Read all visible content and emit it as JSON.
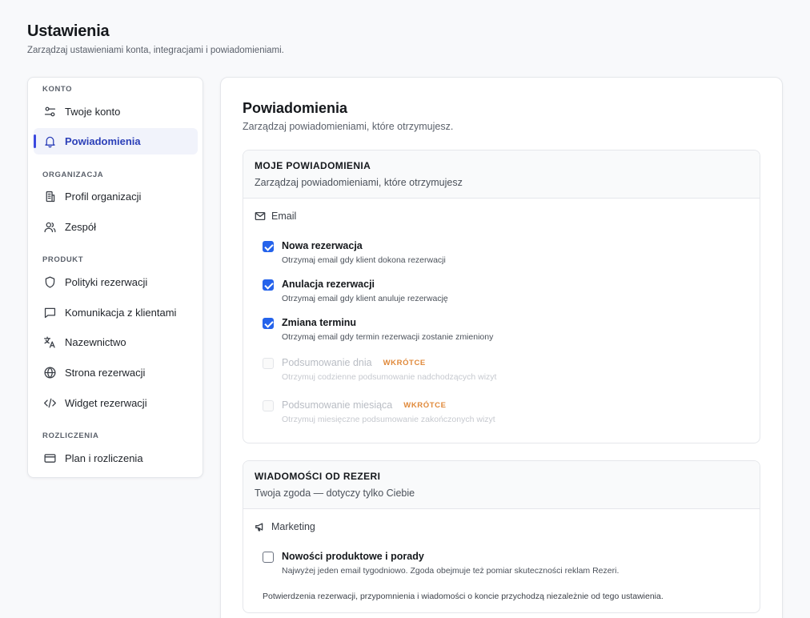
{
  "page": {
    "title": "Ustawienia",
    "subtitle": "Zarządzaj ustawieniami konta, integracjami i powiadomieniami."
  },
  "sidebar": {
    "sections": [
      {
        "heading": "KONTO",
        "items": [
          {
            "label": "Twoje konto",
            "icon": "sliders-icon"
          },
          {
            "label": "Powiadomienia",
            "icon": "bell-icon",
            "active": true
          }
        ]
      },
      {
        "heading": "ORGANIZACJA",
        "items": [
          {
            "label": "Profil organizacji",
            "icon": "building-icon"
          },
          {
            "label": "Zespół",
            "icon": "users-icon"
          }
        ]
      },
      {
        "heading": "PRODUKT",
        "items": [
          {
            "label": "Polityki rezerwacji",
            "icon": "shield-icon"
          },
          {
            "label": "Komunikacja z klientami",
            "icon": "message-icon"
          },
          {
            "label": "Nazewnictwo",
            "icon": "translate-icon"
          },
          {
            "label": "Strona rezerwacji",
            "icon": "globe-icon"
          },
          {
            "label": "Widget rezerwacji",
            "icon": "code-icon"
          }
        ]
      },
      {
        "heading": "ROZLICZENIA",
        "items": [
          {
            "label": "Plan i rozliczenia",
            "icon": "credit-card-icon"
          }
        ]
      }
    ]
  },
  "main": {
    "title": "Powiadomienia",
    "subtitle": "Zarządzaj powiadomieniami, które otrzymujesz.",
    "cards": [
      {
        "title": "MOJE POWIADOMIENIA",
        "subtitle": "Zarządzaj powiadomieniami, które otrzymujesz",
        "group": {
          "label": "Email",
          "icon": "mail-icon"
        },
        "options": [
          {
            "label": "Nowa rezerwacja",
            "desc": "Otrzymaj email gdy klient dokona rezerwacji",
            "checked": true
          },
          {
            "label": "Anulacja rezerwacji",
            "desc": "Otrzymaj email gdy klient anuluje rezerwację",
            "checked": true
          },
          {
            "label": "Zmiana terminu",
            "desc": "Otrzymaj email gdy termin rezerwacji zostanie zmieniony",
            "checked": true
          },
          {
            "label": "Podsumowanie dnia",
            "desc": "Otrzymuj codzienne podsumowanie nadchodzących wizyt",
            "checked": false,
            "disabled": true,
            "badge": "WKRÓTCE"
          },
          {
            "label": "Podsumowanie miesiąca",
            "desc": "Otrzymuj miesięczne podsumowanie zakończonych wizyt",
            "checked": false,
            "disabled": true,
            "badge": "WKRÓTCE"
          }
        ]
      },
      {
        "title": "WIADOMOŚCI OD REZERI",
        "subtitle": "Twoja zgoda — dotyczy tylko Ciebie",
        "group": {
          "label": "Marketing",
          "icon": "megaphone-icon"
        },
        "options": [
          {
            "label": "Nowości produktowe i porady",
            "desc": "Najwyżej jeden email tygodniowo. Zgoda obejmuje też pomiar skuteczności reklam Rezeri.",
            "checked": false
          }
        ],
        "note": "Potwierdzenia rezerwacji, przypomnienia i wiadomości o koncie przychodzą niezależnie od tego ustawienia."
      }
    ]
  },
  "colors": {
    "accent": "#2563eb",
    "active_nav": "#2b3fb8",
    "badge": "#e0893a"
  }
}
